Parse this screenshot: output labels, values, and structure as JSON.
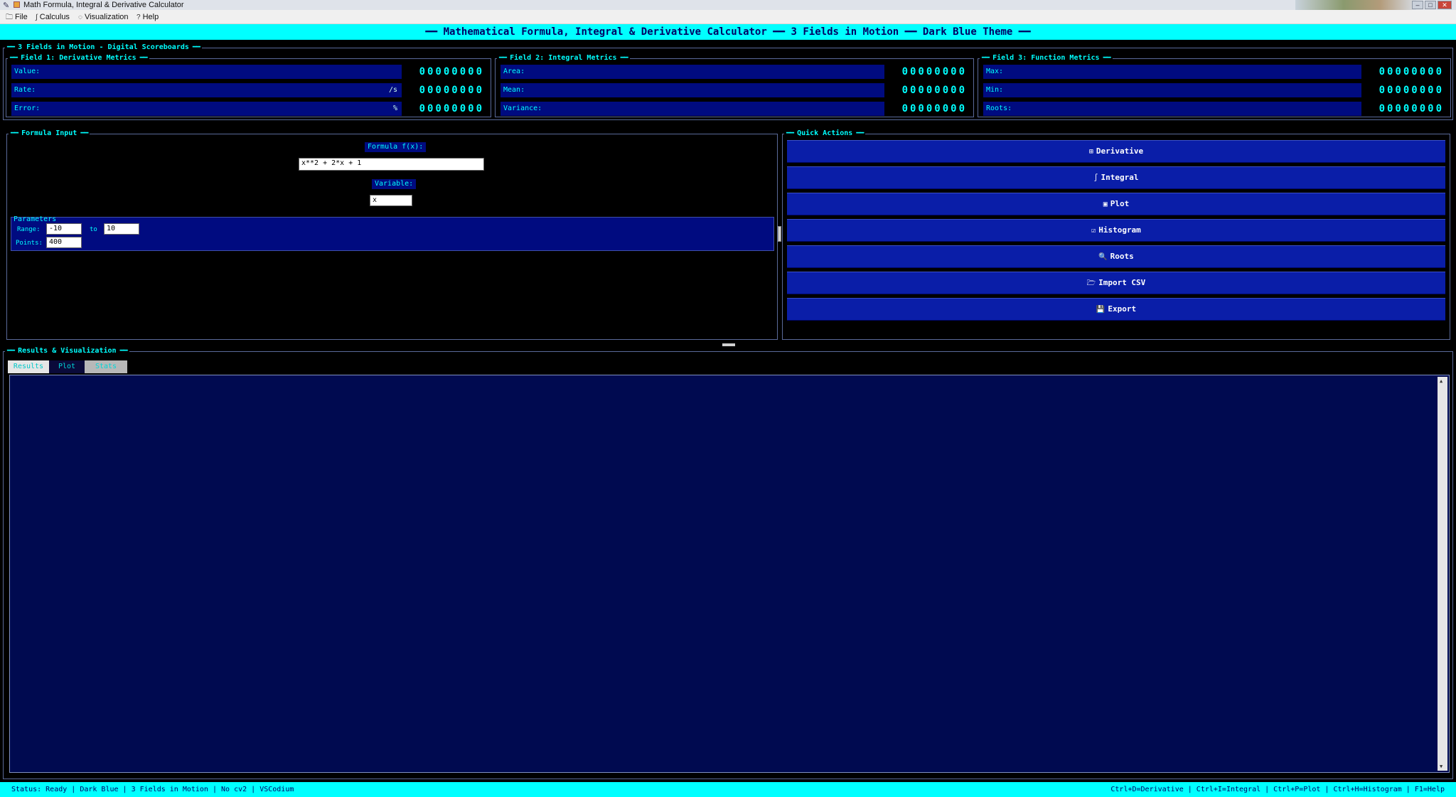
{
  "window": {
    "title": "Math Formula, Integral & Derivative Calculator"
  },
  "menu": {
    "items": [
      {
        "icon": "🗀",
        "label": "File"
      },
      {
        "icon": "∫",
        "label": "Calculus"
      },
      {
        "icon": "◌",
        "label": "Visualization"
      },
      {
        "icon": "?",
        "label": "Help"
      }
    ]
  },
  "header": {
    "text": "━━ Mathematical Formula, Integral & Derivative Calculator ━━ 3 Fields in Motion ━━ Dark Blue Theme ━━"
  },
  "scoreboards": {
    "title": "3 Fields in Motion - Digital Scoreboards",
    "fields": [
      {
        "title": "Field 1: Derivative Metrics",
        "rows": [
          {
            "label": "Value:",
            "unit": "",
            "digits": "00000000"
          },
          {
            "label": "Rate:",
            "unit": "/s",
            "digits": "00000000"
          },
          {
            "label": "Error:",
            "unit": "%",
            "digits": "00000000"
          }
        ]
      },
      {
        "title": "Field 2: Integral Metrics",
        "rows": [
          {
            "label": "Area:",
            "unit": "",
            "digits": "00000000"
          },
          {
            "label": "Mean:",
            "unit": "",
            "digits": "00000000"
          },
          {
            "label": "Variance:",
            "unit": "",
            "digits": "00000000"
          }
        ]
      },
      {
        "title": "Field 3: Function Metrics",
        "rows": [
          {
            "label": "Max:",
            "unit": "",
            "digits": "00000000"
          },
          {
            "label": "Min:",
            "unit": "",
            "digits": "00000000"
          },
          {
            "label": "Roots:",
            "unit": "",
            "digits": "00000000"
          }
        ]
      }
    ]
  },
  "formula": {
    "title": "Formula Input",
    "formula_label": "Formula f(x):",
    "formula_value": "x**2 + 2*x + 1",
    "variable_label": "Variable:",
    "variable_value": "x",
    "parameters": {
      "title": "Parameters",
      "range_label": "Range:",
      "range_from": "-10",
      "to_label": "to",
      "range_to": "10",
      "points_label": "Points:",
      "points_value": "400"
    }
  },
  "quick_actions": {
    "title": "Quick Actions",
    "buttons": [
      {
        "icon": "⊞",
        "label": "Derivative"
      },
      {
        "icon": "∫",
        "label": "Integral"
      },
      {
        "icon": "▣",
        "label": "Plot"
      },
      {
        "icon": "☑",
        "label": "Histogram"
      },
      {
        "icon": "🔍",
        "label": "Roots"
      },
      {
        "icon": "🗁",
        "label": "Import CSV"
      },
      {
        "icon": "💾",
        "label": "Export"
      }
    ]
  },
  "results": {
    "title": "Results & Visualization",
    "tabs": [
      "Results",
      "Plot",
      "Stats"
    ]
  },
  "status": {
    "left": "Status: Ready | Dark Blue | 3 Fields in Motion | No cv2 | VSCodium",
    "right": "Ctrl+D=Derivative | Ctrl+I=Integral | Ctrl+P=Plot | Ctrl+H=Histogram | F1=Help"
  },
  "colors": {
    "accent": "#00ffff",
    "panel": "#000b80",
    "button": "#0a1ea8",
    "background": "#000000",
    "results_bg": "#000a50"
  }
}
